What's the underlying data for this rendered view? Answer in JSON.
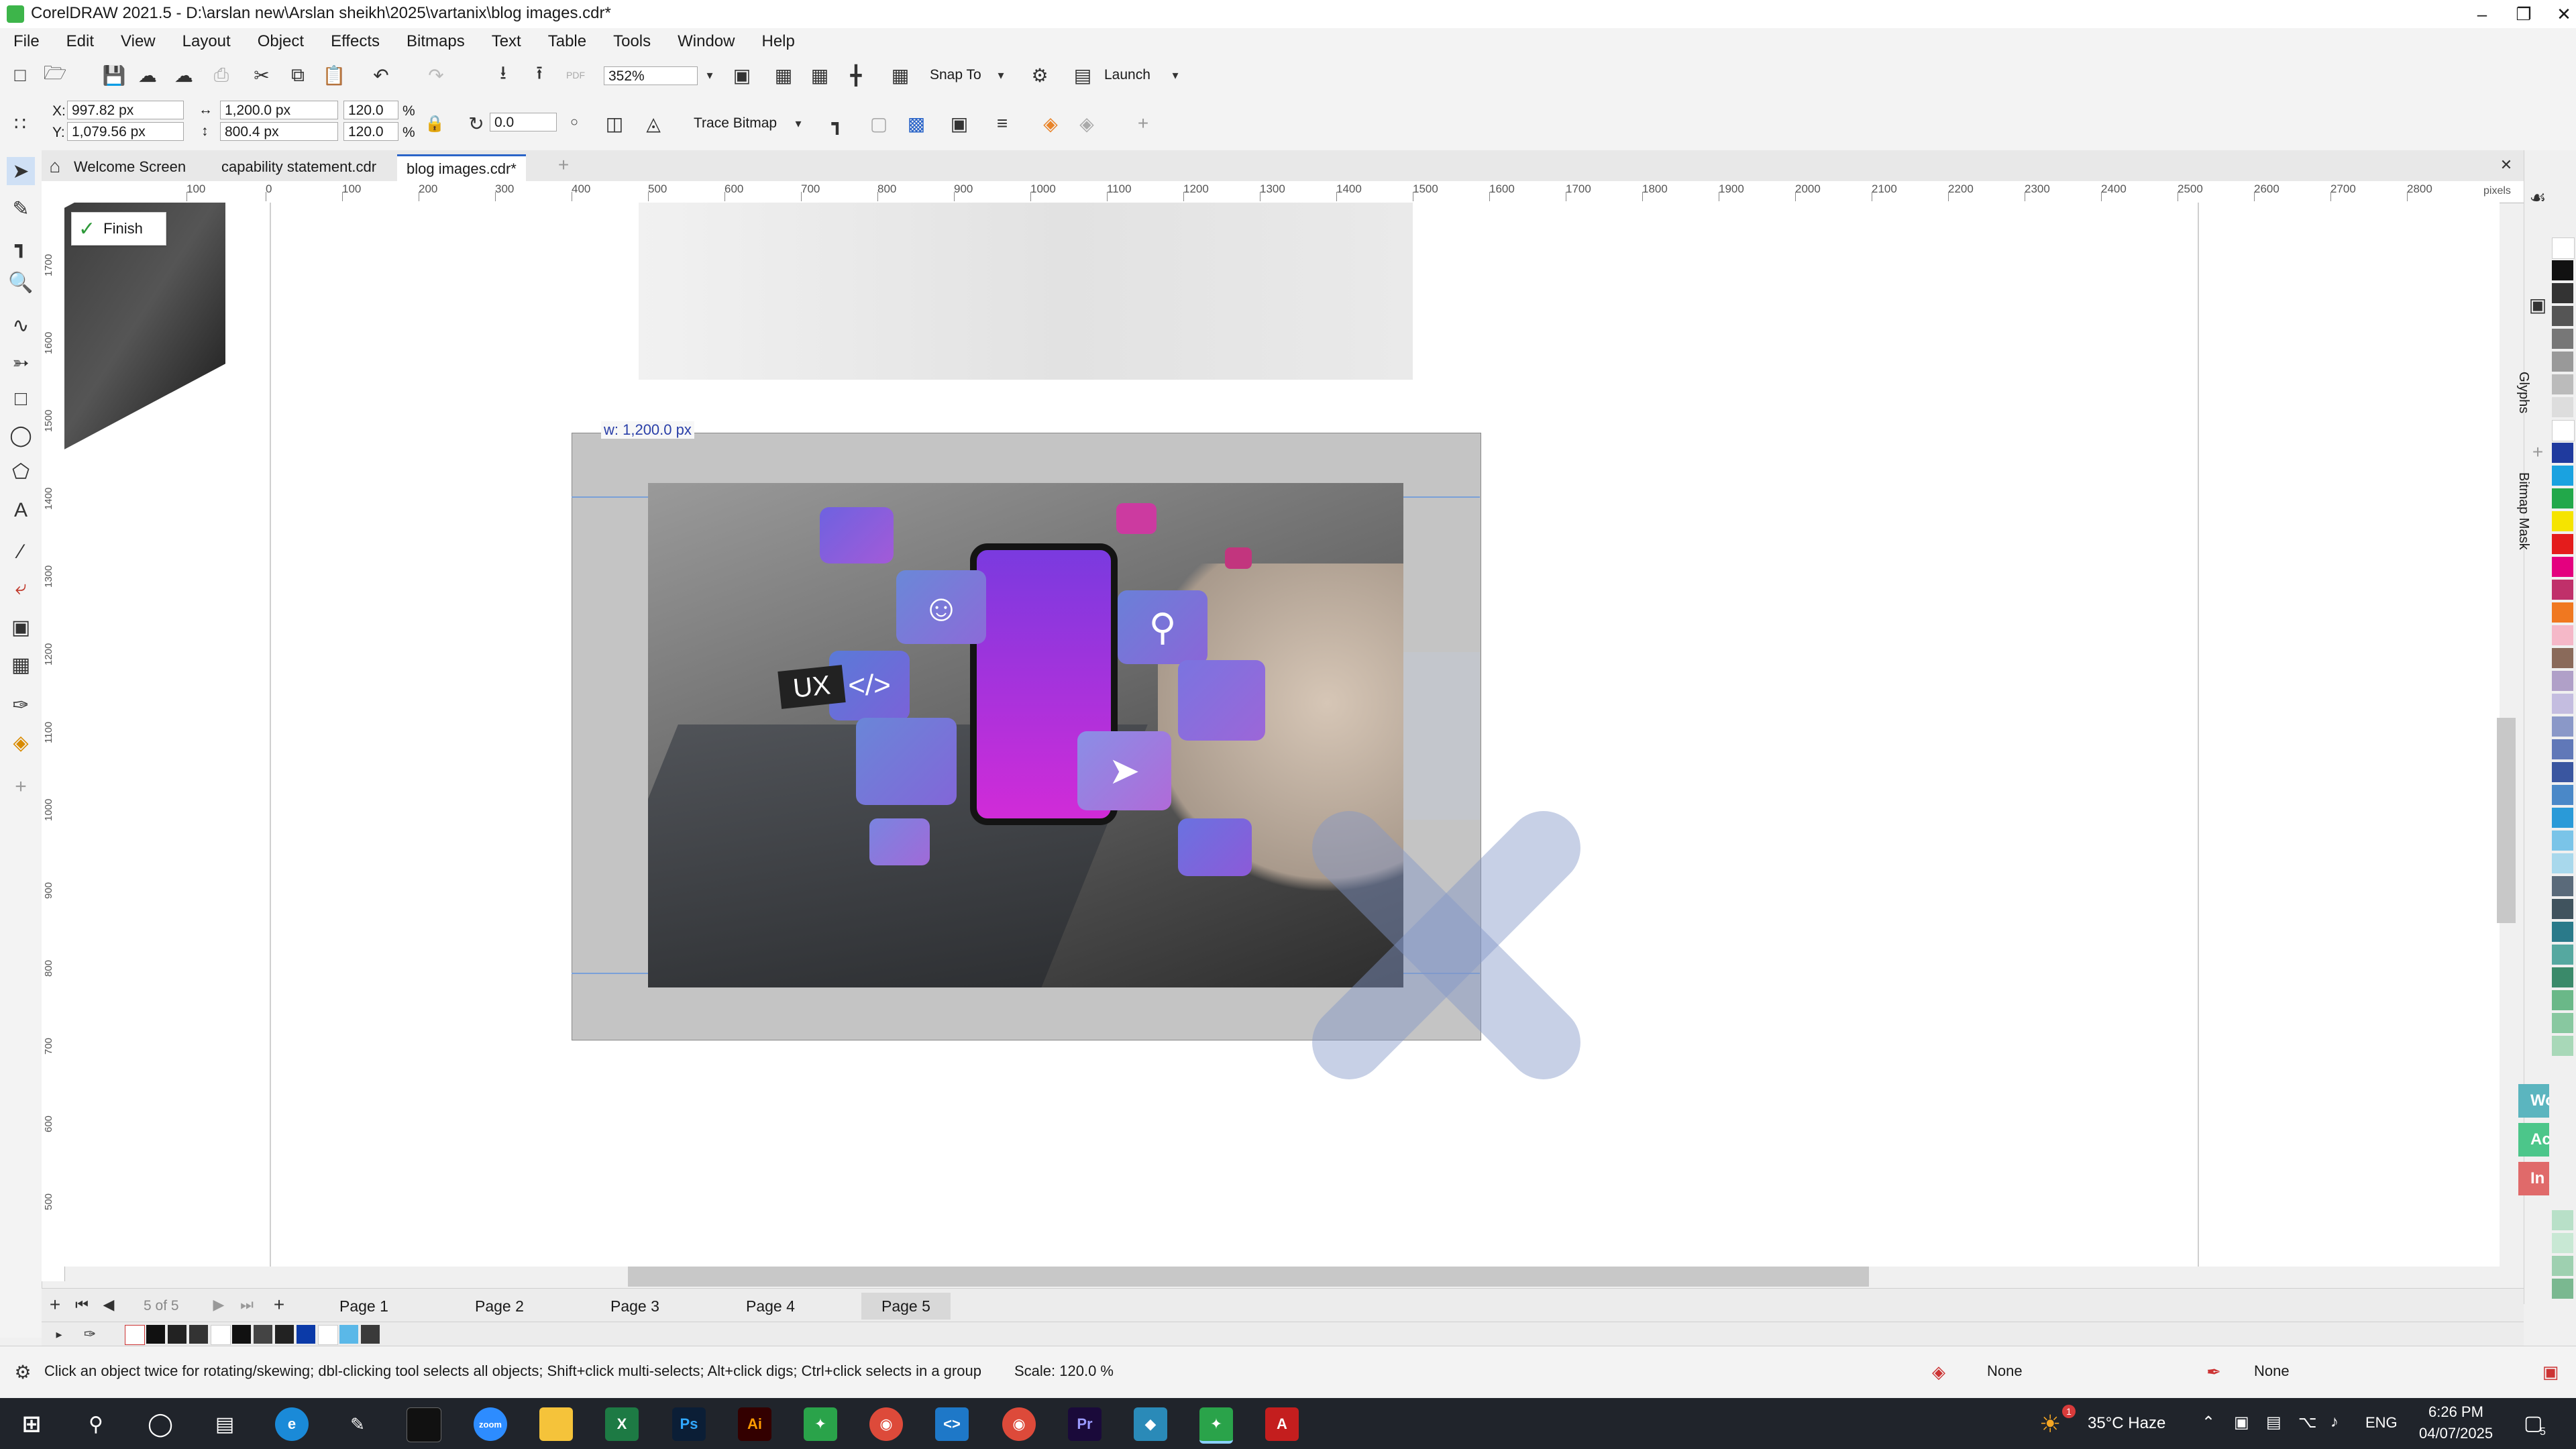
{
  "window": {
    "title": "CorelDRAW 2021.5 - D:\\arslan new\\Arslan sheikh\\2025\\vartanix\\blog images.cdr*"
  },
  "menu": [
    "File",
    "Edit",
    "View",
    "Layout",
    "Object",
    "Effects",
    "Bitmaps",
    "Text",
    "Table",
    "Tools",
    "Window",
    "Help"
  ],
  "toolbar": {
    "zoom": "352%",
    "snap_label": "Snap To",
    "launch_label": "Launch",
    "pdf_label": "PDF"
  },
  "props": {
    "x": "997.82 px",
    "y": "1,079.56 px",
    "w": "1,200.0 px",
    "h": "800.4 px",
    "scale_w": "120.0",
    "scale_h": "120.0",
    "pct": "%",
    "x_label": "X:",
    "y_label": "Y:",
    "rotation": "0.0",
    "trace_bitmap": "Trace Bitmap"
  },
  "tabs": [
    {
      "label": "Welcome Screen"
    },
    {
      "label": "capability statement.cdr"
    },
    {
      "label": "blog images.cdr*"
    }
  ],
  "ruler": {
    "unit": "pixels",
    "h_ticks": [
      "100",
      "0",
      "100",
      "200",
      "300",
      "400",
      "500",
      "600",
      "700",
      "800",
      "900",
      "1000",
      "1100",
      "1200",
      "1300",
      "1400",
      "1500",
      "1600",
      "1700",
      "1800",
      "1900",
      "2000",
      "2100",
      "2200",
      "2300",
      "2400",
      "2500",
      "2600",
      "2700",
      "2800"
    ],
    "v_ticks": [
      "1700",
      "1600",
      "1500",
      "1400",
      "1300",
      "1200",
      "1100",
      "1000",
      "900",
      "800",
      "700",
      "600",
      "500"
    ]
  },
  "canvas": {
    "finish_label": "Finish",
    "width_tooltip": "w: 1,200.0 px",
    "ux_label": "UX",
    "code_label": "</>"
  },
  "right_docker": {
    "glyphs": "Glyphs",
    "bitmap_mask": "Bitmap Mask"
  },
  "side_labels": [
    {
      "label": "Work",
      "color": "#5bb5bf"
    },
    {
      "label": "Active",
      "color": "#4cc68a"
    },
    {
      "label": "In Act",
      "color": "#e06a6a"
    }
  ],
  "pages": {
    "counter": "5 of 5",
    "tabs": [
      "Page 1",
      "Page 2",
      "Page 3",
      "Page 4",
      "Page 5"
    ]
  },
  "status": {
    "hint": "Click an object twice for rotating/skewing; dbl-clicking tool selects all objects; Shift+click multi-selects; Alt+click digs; Ctrl+click selects in a group",
    "scale": "Scale: 120.0 %",
    "fill": "None",
    "outline": "None"
  },
  "taskbar": {
    "weather": "35°C  Haze",
    "lang": "ENG",
    "time": "6:26 PM",
    "date": "04/07/2025",
    "notif": "5",
    "weather_badge": "1"
  },
  "colors": {
    "accent": "#2a64c8",
    "selection": "#3a64c8",
    "menu_bg": "#f3f3f3"
  }
}
